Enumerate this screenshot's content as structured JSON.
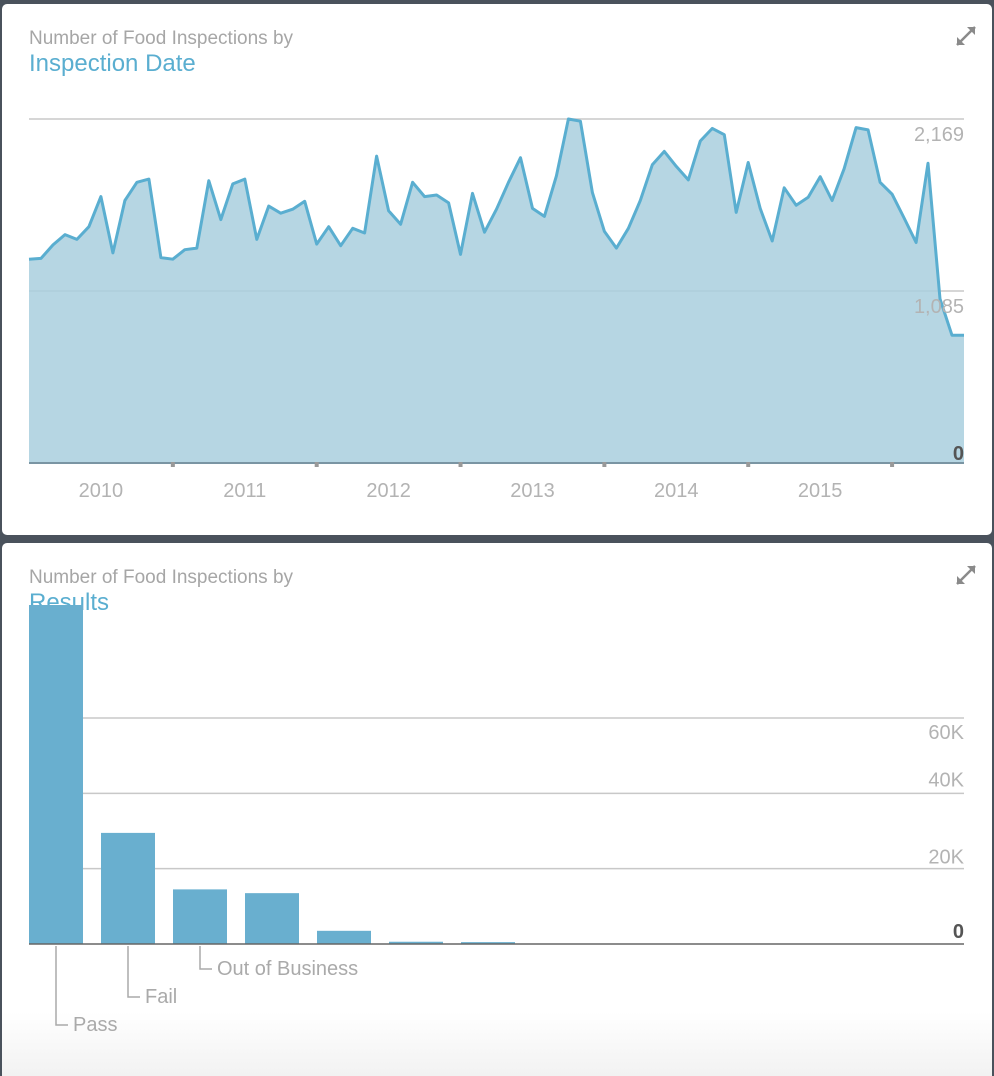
{
  "colors": {
    "accent": "#5aaed0",
    "area_fill": "#a9cfde",
    "bar": "#69afcf",
    "grid": "#c8c8c8",
    "tick": "#b3b3b3"
  },
  "panels": [
    {
      "title_prefix": "Number of Food Inspections by",
      "title_main": "Inspection Date",
      "expand_icon": "expand-arrows-icon"
    },
    {
      "title_prefix": "Number of Food Inspections by",
      "title_main": "Results",
      "expand_icon": "expand-arrows-icon"
    }
  ],
  "chart_data": [
    {
      "type": "area",
      "x_start": "2009-07",
      "x_step": "month",
      "x_ticklabels": [
        "2010",
        "2011",
        "2012",
        "2013",
        "2014",
        "2015"
      ],
      "y_ticklabels": [
        "2,169",
        "1,085",
        "0"
      ],
      "ylim": [
        0,
        2169
      ],
      "grid": true,
      "values": [
        1285,
        1290,
        1375,
        1440,
        1410,
        1490,
        1680,
        1325,
        1655,
        1770,
        1790,
        1295,
        1285,
        1345,
        1355,
        1780,
        1535,
        1760,
        1790,
        1410,
        1620,
        1575,
        1600,
        1650,
        1380,
        1490,
        1370,
        1480,
        1450,
        1935,
        1590,
        1505,
        1770,
        1680,
        1690,
        1640,
        1315,
        1700,
        1455,
        1600,
        1770,
        1925,
        1605,
        1555,
        1810,
        2169,
        2155,
        1705,
        1460,
        1355,
        1480,
        1655,
        1880,
        1965,
        1870,
        1785,
        2030,
        2110,
        2070,
        1580,
        1895,
        1605,
        1400,
        1735,
        1625,
        1675,
        1805,
        1655,
        1855,
        2115,
        2100,
        1770,
        1695,
        1545,
        1390,
        1890,
        1035,
        805,
        805
      ]
    },
    {
      "type": "bar",
      "categories": [
        "Pass",
        "Fail",
        "Out of Business",
        "",
        "",
        "",
        ""
      ],
      "values": [
        90000,
        29500,
        14500,
        13500,
        3500,
        600,
        500
      ],
      "y_ticks": [
        0,
        20000,
        40000,
        60000
      ],
      "y_ticklabels": [
        "0",
        "20K",
        "40K",
        "60K"
      ],
      "grid": true
    }
  ]
}
